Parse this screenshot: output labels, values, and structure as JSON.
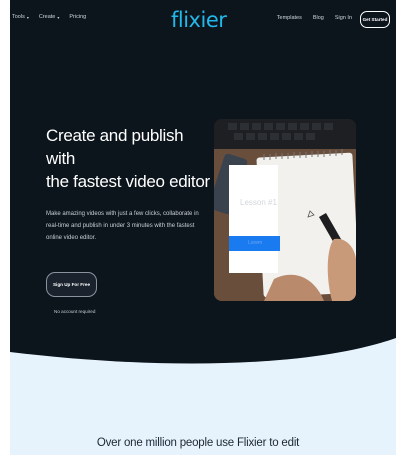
{
  "nav": {
    "left": [
      {
        "label": "Tools",
        "caret": "▾"
      },
      {
        "label": "Create",
        "caret": "▾"
      },
      {
        "label": "Pricing",
        "caret": ""
      }
    ],
    "logo": "flixier",
    "right": [
      "Templates",
      "Blog",
      "Sign In"
    ],
    "cta": "Get Started"
  },
  "hero": {
    "headline_line1": "Create and publish with",
    "headline_line2": "the fastest video editor",
    "description": "Make amazing videos with just a few clicks, collaborate in real-time and publish in under 3 minutes with the fastest online video editor.",
    "signup_button": "Sign Up For Free",
    "signup_note": "No account required"
  },
  "preview": {
    "card_title": "Lesson #1",
    "card_bar_text": "Lorem"
  },
  "section": {
    "heading": "Over one million people use Flixier to edit"
  },
  "colors": {
    "hero_bg": "#0c141c",
    "logo": "#22b8ea",
    "lower_bg": "#e7f3fc",
    "accent_blue": "#1a7bf0"
  }
}
